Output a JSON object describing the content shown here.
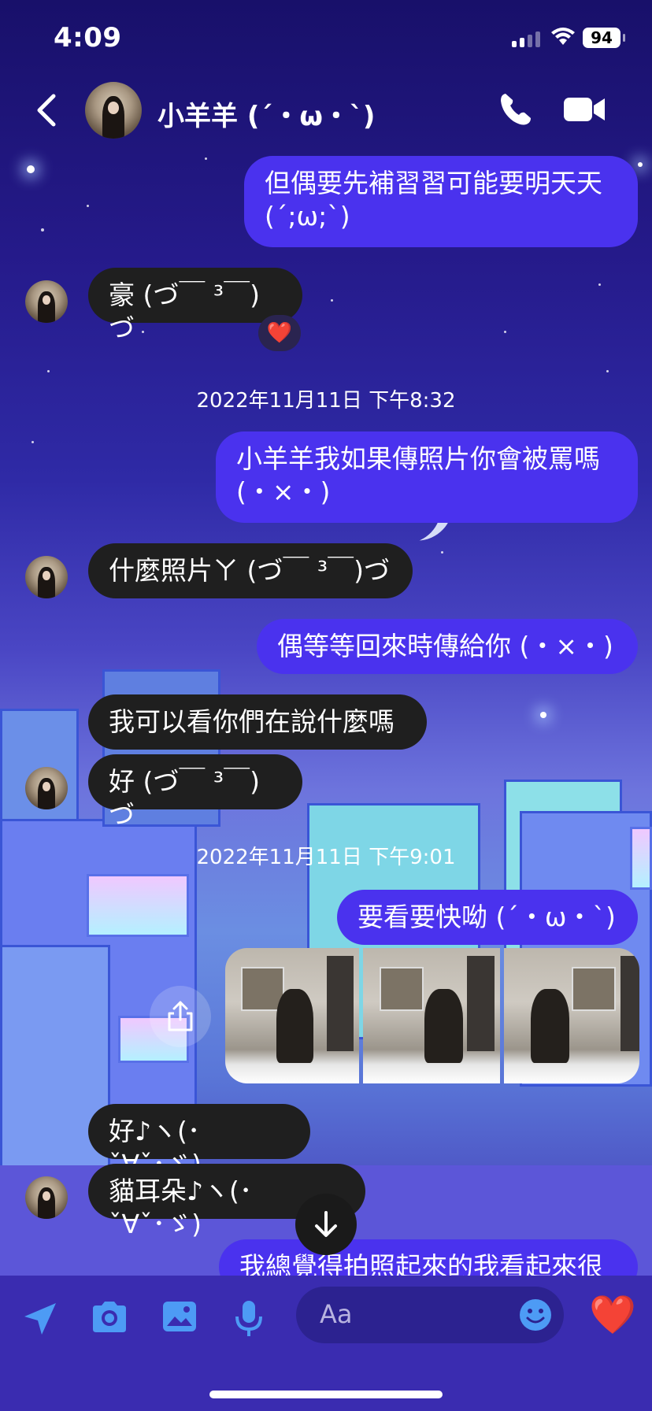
{
  "status_bar": {
    "time": "4:09",
    "battery": "94"
  },
  "header": {
    "contact_name": "小羊羊 (´・ω・`)",
    "icons": [
      "back-chevron-icon",
      "phone-icon",
      "video-camera-icon"
    ]
  },
  "messages": [
    {
      "side": "out",
      "text": "但偶要先補習習可能要明天天\n(´;ω;`)"
    },
    {
      "side": "in",
      "text": "豪 (づ￣ ³￣)づ",
      "reaction": "❤️"
    },
    {
      "type": "timestamp",
      "text": "2022年11月11日 下午8:32"
    },
    {
      "side": "out",
      "text": "小羊羊我如果傳照片你會被罵嗎\n(・×・)"
    },
    {
      "side": "in",
      "text": "什麼照片ㄚ (づ￣ ³￣)づ"
    },
    {
      "side": "out",
      "text": "偶等等回來時傳給你 (・×・)"
    },
    {
      "side": "in",
      "text": "我可以看你們在說什麼嗎"
    },
    {
      "side": "in",
      "text": "好 (づ￣ ³￣)づ"
    },
    {
      "type": "timestamp",
      "text": "2022年11月11日 下午9:01"
    },
    {
      "side": "out",
      "text": "要看要快呦 (´・ω・`)"
    },
    {
      "side": "in",
      "text": "好♪ヽ(･ˇ∀ˇ･ゞ)"
    },
    {
      "side": "in",
      "text": "貓耳朵♪ヽ(･ˇ∀ˇ･ゞ)"
    },
    {
      "side": "out",
      "text": "我總覺得拍照起來的我看起來很"
    }
  ],
  "composer": {
    "placeholder": "Aa",
    "icons": [
      "location-arrow-icon",
      "camera-icon",
      "gallery-icon",
      "microphone-icon",
      "emoji-icon",
      "heart-icon"
    ],
    "like_emoji": "❤️"
  },
  "colors": {
    "outgoing_bubble": "#4a32ee",
    "incoming_bubble": "#1f1f1f",
    "composer_bg": "#3a2cb0"
  }
}
